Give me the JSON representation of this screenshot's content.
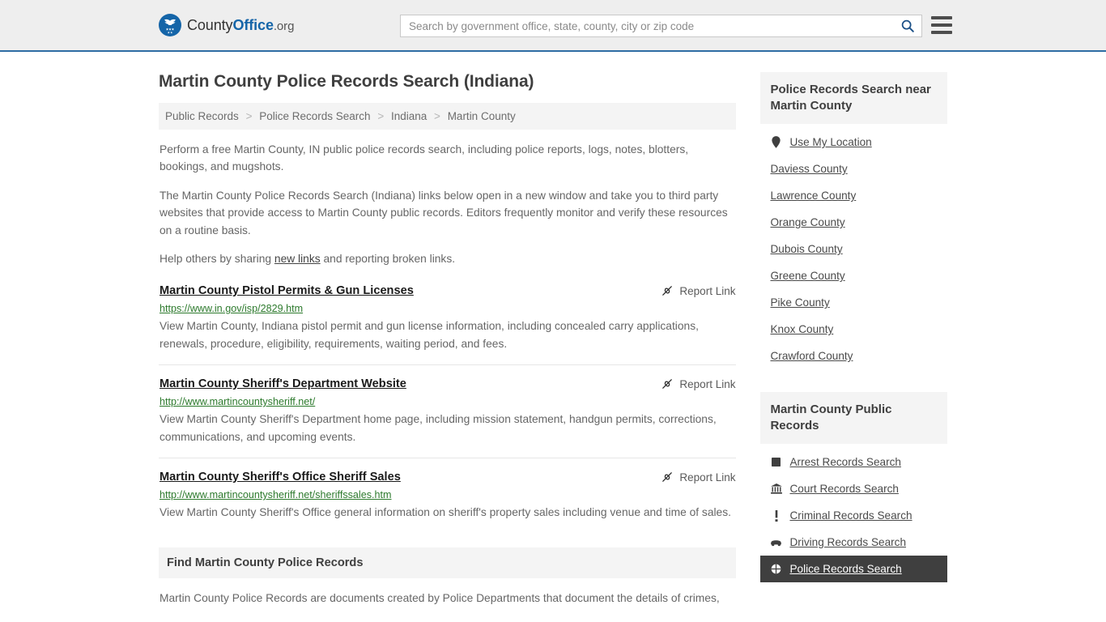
{
  "header": {
    "brand": {
      "part1": "County",
      "part2": "Office",
      "part3": ".org"
    },
    "search": {
      "placeholder": "Search by government office, state, county, city or zip code",
      "value": ""
    },
    "search_icon": "search-icon",
    "menu_icon": "hamburger-menu-icon",
    "accent_color": "#2e6da4"
  },
  "main": {
    "title": "Martin County Police Records Search (Indiana)",
    "breadcrumb": [
      "Public Records",
      "Police Records Search",
      "Indiana",
      "Martin County"
    ],
    "breadcrumb_separator": ">",
    "intro": [
      "Perform a free Martin County, IN public police records search, including police reports, logs, notes, blotters, bookings, and mugshots.",
      "The Martin County Police Records Search (Indiana) links below open in a new window and take you to third party websites that provide access to Martin County public records. Editors frequently monitor and verify these resources on a routine basis."
    ],
    "help_prefix": "Help others by sharing ",
    "help_link": "new links",
    "help_suffix": " and reporting broken links.",
    "report_link_label": "Report Link",
    "report_link_icon": "broken-link-icon",
    "results": [
      {
        "title": "Martin County Pistol Permits & Gun Licenses",
        "url": "https://www.in.gov/isp/2829.htm",
        "description": "View Martin County, Indiana pistol permit and gun license information, including concealed carry applications, renewals, procedure, eligibility, requirements, waiting period, and fees."
      },
      {
        "title": "Martin County Sheriff's Department Website",
        "url": "http://www.martincountysheriff.net/",
        "description": "View Martin County Sheriff's Department home page, including mission statement, handgun permits, corrections, communications, and upcoming events."
      },
      {
        "title": "Martin County Sheriff's Office Sheriff Sales",
        "url": "http://www.martincountysheriff.net/sheriffssales.htm",
        "description": "View Martin County Sheriff's Office general information on sheriff's property sales including venue and time of sales."
      }
    ],
    "find_section": {
      "heading": "Find Martin County Police Records",
      "body": "Martin County Police Records are documents created by Police Departments that document the details of crimes,"
    }
  },
  "sidebar": {
    "nearby": {
      "heading": "Police Records Search near Martin County",
      "use_my_location": {
        "label": "Use My Location",
        "icon": "map-pin-icon"
      },
      "counties": [
        "Daviess County",
        "Lawrence County",
        "Orange County",
        "Dubois County",
        "Greene County",
        "Pike County",
        "Knox County",
        "Crawford County"
      ]
    },
    "public_records": {
      "heading": "Martin County Public Records",
      "items": [
        {
          "label": "Arrest Records Search",
          "icon": "square-icon",
          "active": false
        },
        {
          "label": "Court Records Search",
          "icon": "courthouse-icon",
          "active": false
        },
        {
          "label": "Criminal Records Search",
          "icon": "exclamation-icon",
          "active": false
        },
        {
          "label": "Driving Records Search",
          "icon": "car-icon",
          "active": false
        },
        {
          "label": "Police Records Search",
          "icon": "badge-icon",
          "active": true
        }
      ]
    }
  }
}
